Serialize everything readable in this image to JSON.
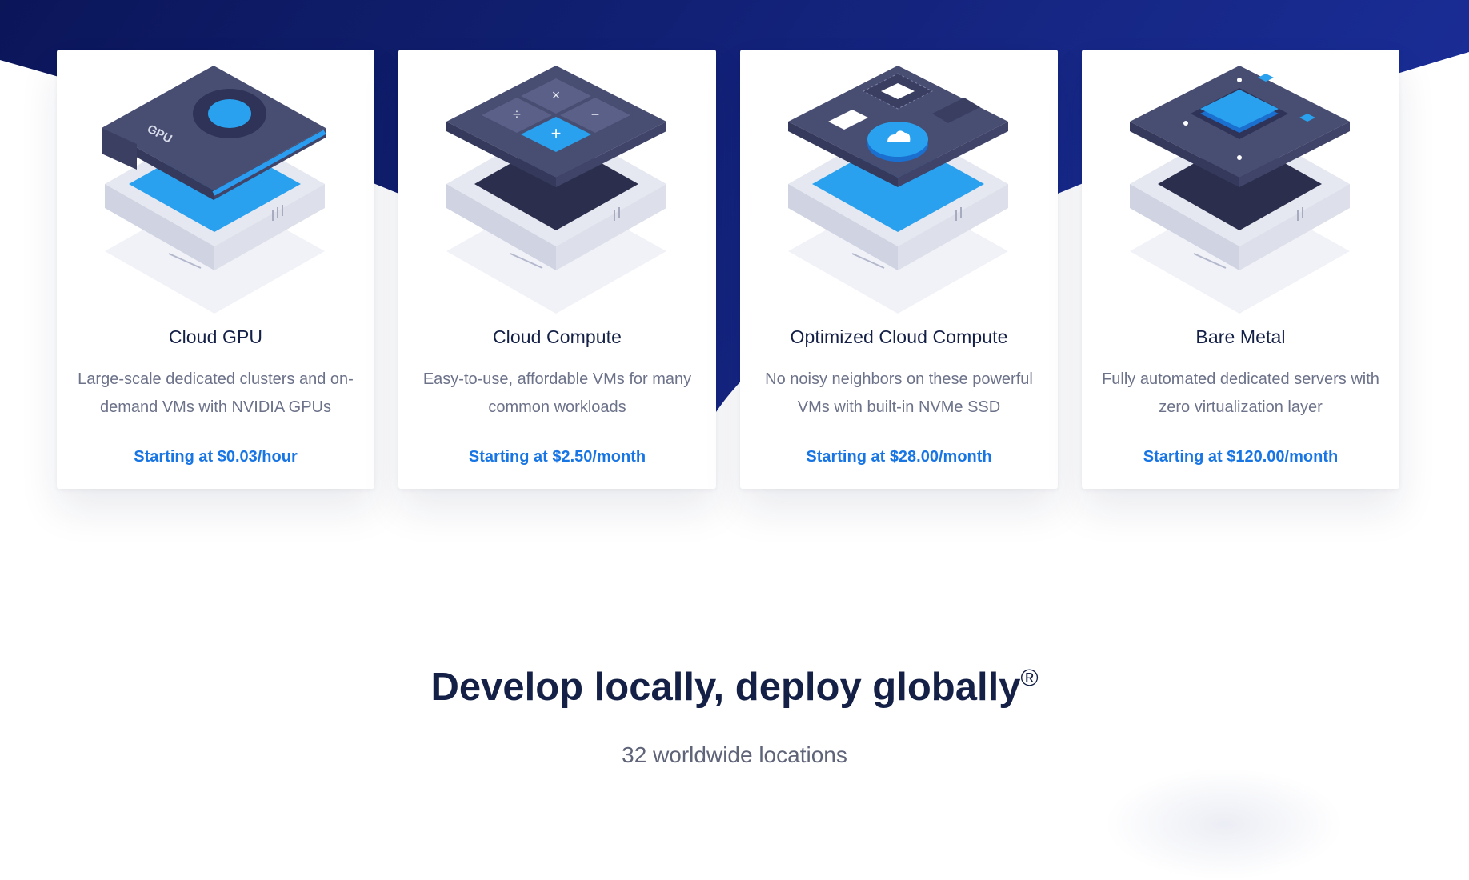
{
  "colors": {
    "hero_dark": "#0b1659",
    "hero_light": "#1a2d96",
    "card_title": "#142046",
    "card_text": "#6c7289",
    "price_blue": "#1875e4",
    "accent_blue": "#1e8cf0"
  },
  "products": [
    {
      "icon": "gpu-card-icon",
      "title": "Cloud GPU",
      "description": "Large-scale dedicated clusters and on-demand VMs with NVIDIA GPUs",
      "price": "Starting at $0.03/hour",
      "chip_label": "GPU"
    },
    {
      "icon": "calculator-icon",
      "title": "Cloud Compute",
      "description": "Easy-to-use, affordable VMs for many common workloads",
      "price": "Starting at $2.50/month"
    },
    {
      "icon": "cloud-chip-icon",
      "title": "Optimized Cloud Compute",
      "description": "No noisy neighbors on these powerful VMs with built-in NVMe SSD",
      "price": "Starting at $28.00/month"
    },
    {
      "icon": "bare-metal-chip-icon",
      "title": "Bare Metal",
      "description": "Fully automated dedicated servers with zero virtualization layer",
      "price": "Starting at $120.00/month"
    }
  ],
  "section": {
    "headline": "Develop locally, deploy globally",
    "headline_mark": "®",
    "subheadline": "32 worldwide locations"
  }
}
